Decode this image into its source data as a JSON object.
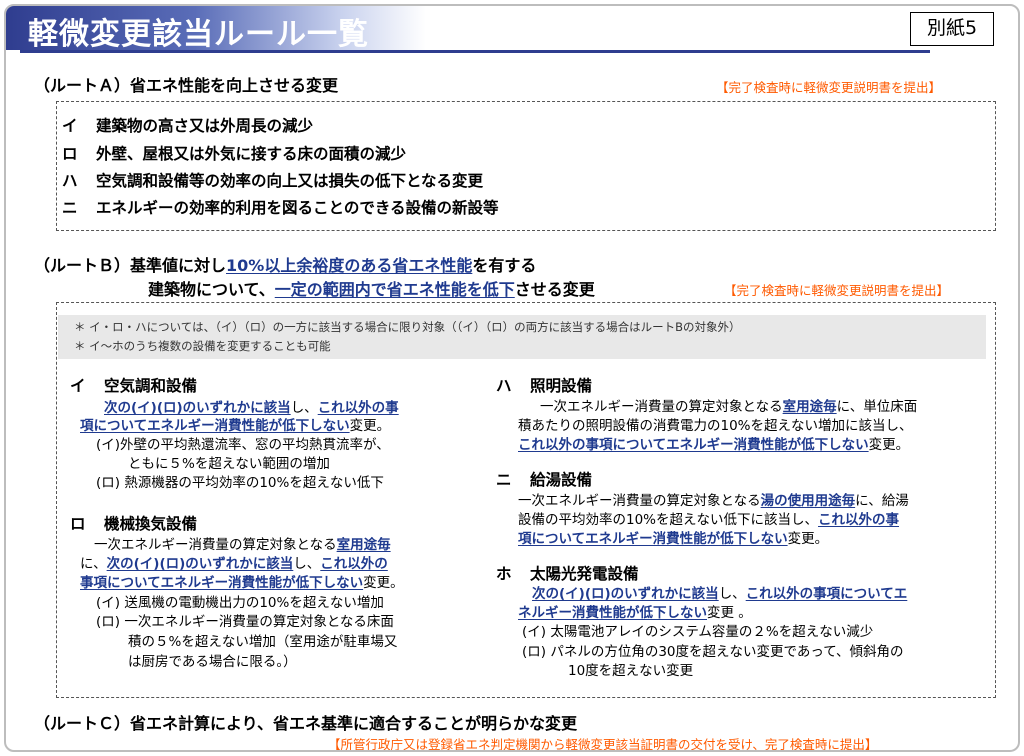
{
  "title": "軽微変更該当ルール一覧",
  "attachment_label": "別紙5",
  "route_a": {
    "heading": "（ルートＡ）省エネ性能を向上させる変更",
    "note": "【完了検査時に軽微変更説明書を提出】",
    "items": [
      {
        "key": "イ",
        "text": "建築物の高さ又は外周長の減少"
      },
      {
        "key": "ロ",
        "text": "外壁、屋根又は外気に接する床の面積の減少"
      },
      {
        "key": "ハ",
        "text": "空気調和設備等の効率の向上又は損失の低下となる変更"
      },
      {
        "key": "ニ",
        "text": "エネルギーの効率的利用を図ることのできる設備の新設等"
      }
    ]
  },
  "route_b": {
    "heading_line1_a": "（ルートＢ）基準値に対し",
    "heading_line1_u": "10%以上余裕度のある省エネ性能",
    "heading_line1_b": "を有する",
    "heading_line2_a": "建築物について、",
    "heading_line2_u": "一定の範囲内で省エネ性能を低下",
    "heading_line2_b": "させる変更",
    "note": "【完了検査時に軽微変更説明書を提出】",
    "remarks": [
      "＊ イ・ロ・ハについては、（イ）（ロ）の一方に該当する場合に限り対象（（イ）（ロ）の両方に該当する場合はルートBの対象外）",
      "＊ イ～ホのうち複数の設備を変更することも可能"
    ],
    "i": {
      "key": "イ",
      "title": "空気調和設備",
      "l1_u1": "次の(イ)(ロ)のいずれかに該当",
      "l1_t": "し、",
      "l1_u2": "これ以外の事",
      "l2_u": "項についてエネルギー消費性能が低下しない",
      "l2_t": "変更。",
      "sub1_a": "(イ)外壁の平均熱還流率、窓の平均熱貫流率が、",
      "sub1_b": "ともに５%を超えない範囲の増加",
      "sub2": "(ロ) 熱源機器の平均効率の10%を超えない低下"
    },
    "ro": {
      "key": "ロ",
      "title": "機械換気設備",
      "l1_t": "一次エネルギー消費量の算定対象となる",
      "l1_u": "室用途毎",
      "l2_t1": "に、",
      "l2_u1": "次の(イ)(ロ)のいずれかに該当",
      "l2_t2": "し、",
      "l2_u2": "これ以外の",
      "l3_u": "事項についてエネルギー消費性能が低下しない",
      "l3_t": "変更。",
      "sub1": "(イ) 送風機の電動機出力の10%を超えない増加",
      "sub2_a": "(ロ) 一次エネルギー消費量の算定対象となる床面",
      "sub2_b": "積の５%を超えない増加（室用途が駐車場又",
      "sub2_c": "は厨房である場合に限る。）"
    },
    "ha": {
      "key": "ハ",
      "title": "照明設備",
      "l1_t1": "一次エネルギー消費量の算定対象となる",
      "l1_u": "室用途毎",
      "l1_t2": "に、単位床面",
      "l2": "積あたりの照明設備の消費電力の10%を超えない増加に該当し、",
      "l3_u": "これ以外の事項についてエネルギー消費性能が低下しない",
      "l3_t": "変更。"
    },
    "ni": {
      "key": "ニ",
      "title": "給湯設備",
      "l1_t1": "一次エネルギー消費量の算定対象となる",
      "l1_u": "湯の使用用途毎",
      "l1_t2": "に、給湯",
      "l2_t": "設備の平均効率の10%を超えない低下に該当し、",
      "l2_u": "これ以外の事",
      "l3_u": "項についてエネルギー消費性能が低下しない",
      "l3_t": "変更。"
    },
    "ho": {
      "key": "ホ",
      "title": "太陽光発電設備",
      "l1_u1": "次の(イ)(ロ)のいずれかに該当",
      "l1_t": "し、",
      "l1_u2": "これ以外の事項についてエ",
      "l2_u": "ネルギー消費性能が低下しない",
      "l2_t": "変更 。",
      "sub1": "(イ) 太陽電池アレイのシステム容量の２%を超えない減少",
      "sub2_a": "(ロ) パネルの方位角の30度を超えない変更であって、傾斜角の",
      "sub2_b": "10度を超えない変更"
    }
  },
  "route_c": {
    "heading": "（ルートＣ）省エネ計算により、省エネ基準に適合することが明らかな変更",
    "note": "【所管行政庁又は登録省エネ判定機関から軽微変更該当証明書の交付を受け、完了検査時に提出】"
  }
}
